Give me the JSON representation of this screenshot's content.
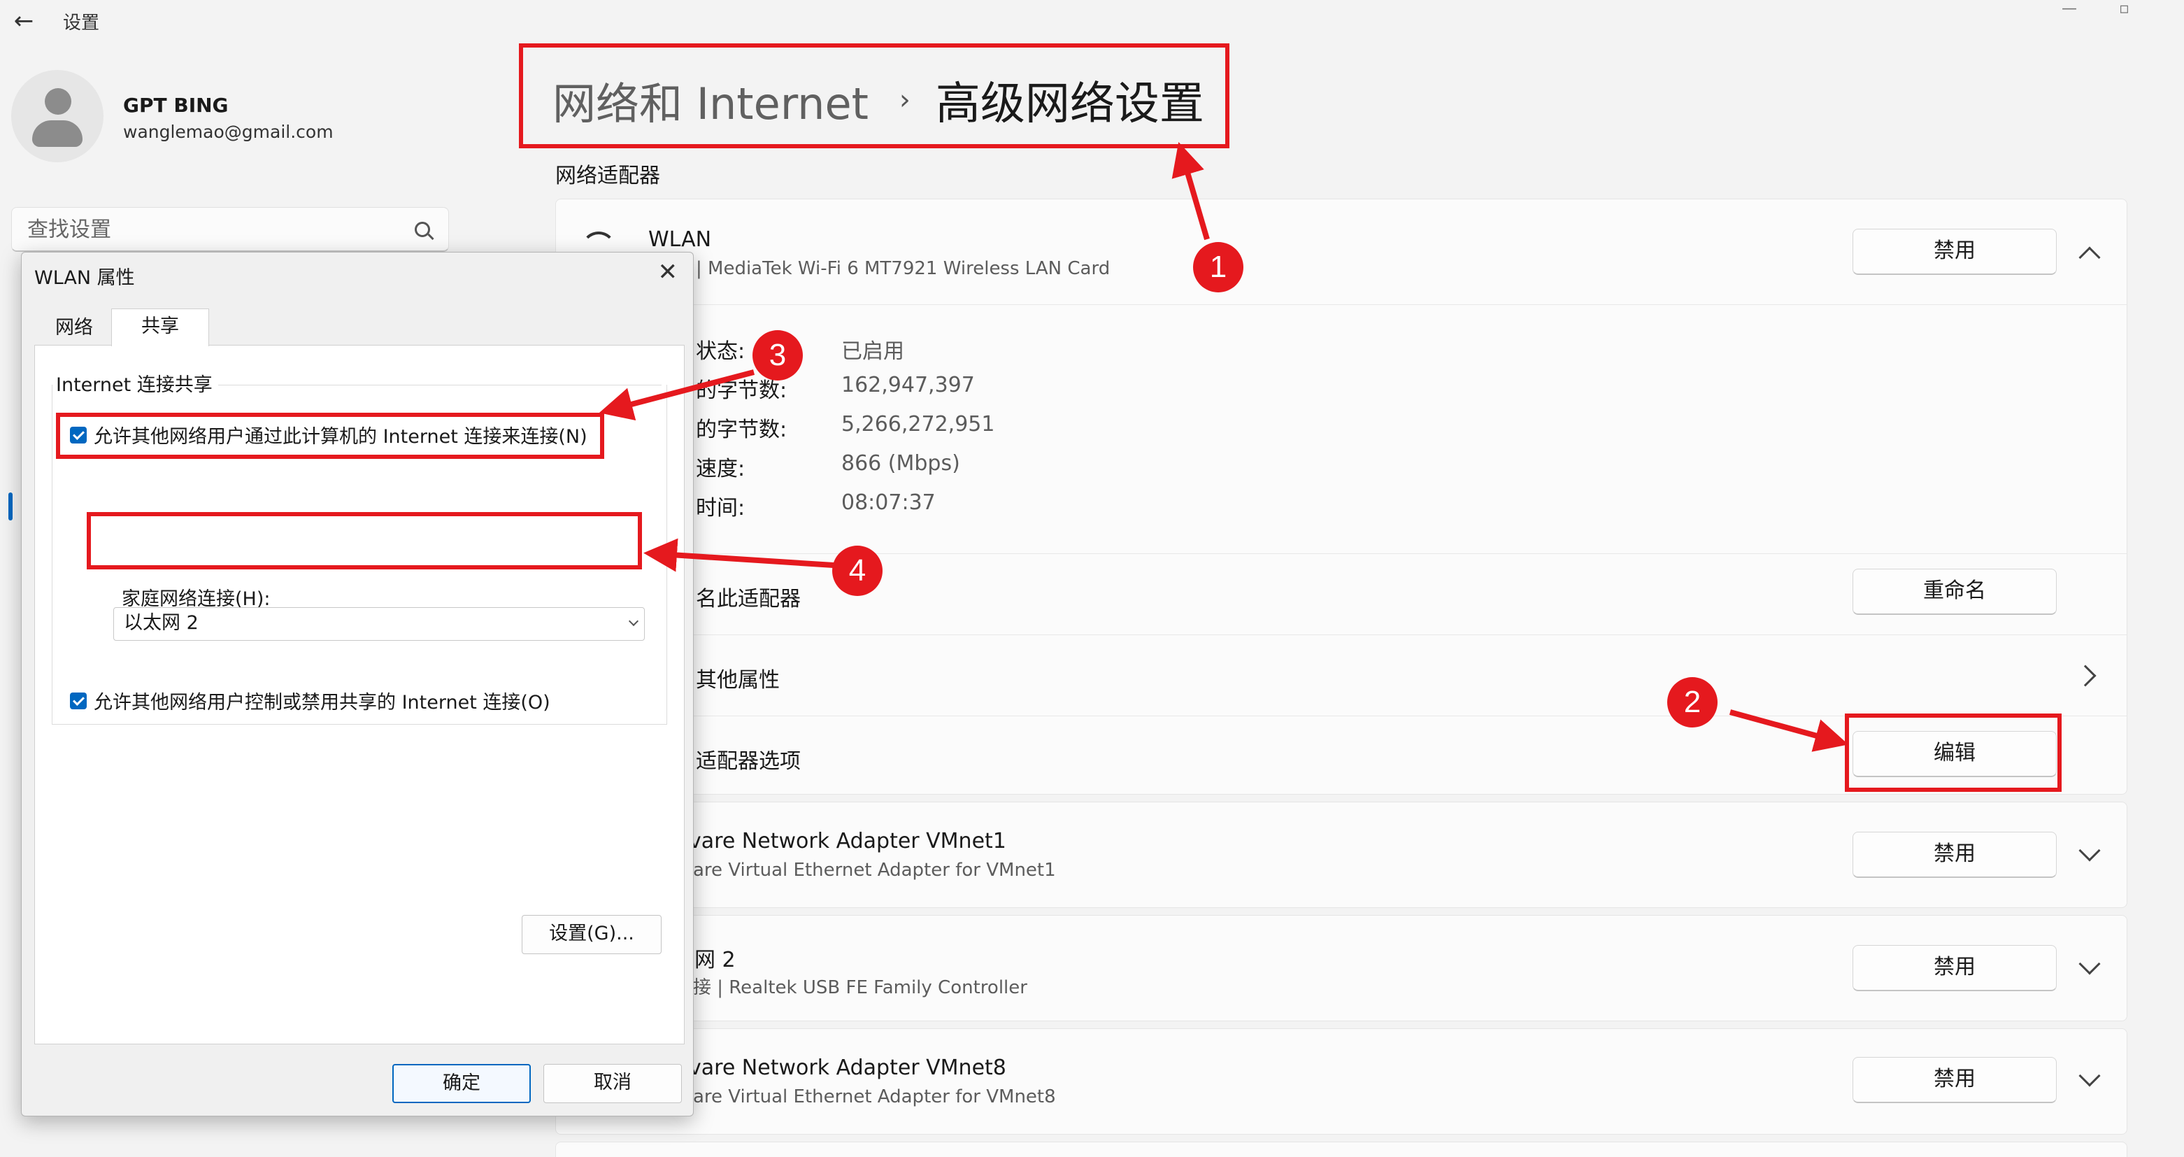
{
  "app": {
    "title": "设置",
    "back_icon": "←"
  },
  "user": {
    "name": "GPT BING",
    "email": "wanglemao@gmail.com"
  },
  "search": {
    "placeholder": "查找设置"
  },
  "breadcrumb": {
    "parent": "网络和 Internet",
    "separator": "›",
    "current": "高级网络设置"
  },
  "section_label": "网络适配器",
  "adapters": [
    {
      "name": "WLAN",
      "description": "| MediaTek Wi-Fi 6 MT7921 Wireless LAN Card",
      "button": "禁用",
      "properties": [
        {
          "label": "状态:",
          "value": "已启用"
        },
        {
          "label": "的字节数:",
          "value": "162,947,397"
        },
        {
          "label": "的字节数:",
          "value": "5,266,272,951"
        },
        {
          "label": "速度:",
          "value": "866 (Mbps)"
        },
        {
          "label": "时间:",
          "value": "08:07:37"
        }
      ],
      "rename_label": "名此适配器",
      "rename_button": "重命名",
      "more_props_label": "其他属性",
      "options_label": "适配器选项",
      "edit_button": "编辑"
    },
    {
      "name": "vare Network Adapter VMnet1",
      "description": "are Virtual Ethernet Adapter for VMnet1",
      "button": "禁用"
    },
    {
      "name": "网 2",
      "description": "接 | Realtek USB FE Family Controller",
      "button": "禁用"
    },
    {
      "name": "vare Network Adapter VMnet8",
      "description": "are Virtual Ethernet Adapter for VMnet8",
      "button": "禁用"
    }
  ],
  "dialog": {
    "title": "WLAN 属性",
    "close_icon": "✕",
    "tabs": [
      "网络",
      "共享"
    ],
    "group_title": "Internet 连接共享",
    "allow_connect": "允许其他网络用户通过此计算机的 Internet 连接来连接(N)",
    "home_network_label": "家庭网络连接(H):",
    "home_network_value": "以太网 2",
    "allow_control": "允许其他网络用户控制或禁用共享的 Internet 连接(O)",
    "settings_button": "设置(G)...",
    "ok_button": "确定",
    "cancel_button": "取消"
  },
  "annotations": [
    "1",
    "2",
    "3",
    "4"
  ],
  "colors": {
    "annotation_red": "#e5191e",
    "accent_blue": "#0067c0"
  }
}
